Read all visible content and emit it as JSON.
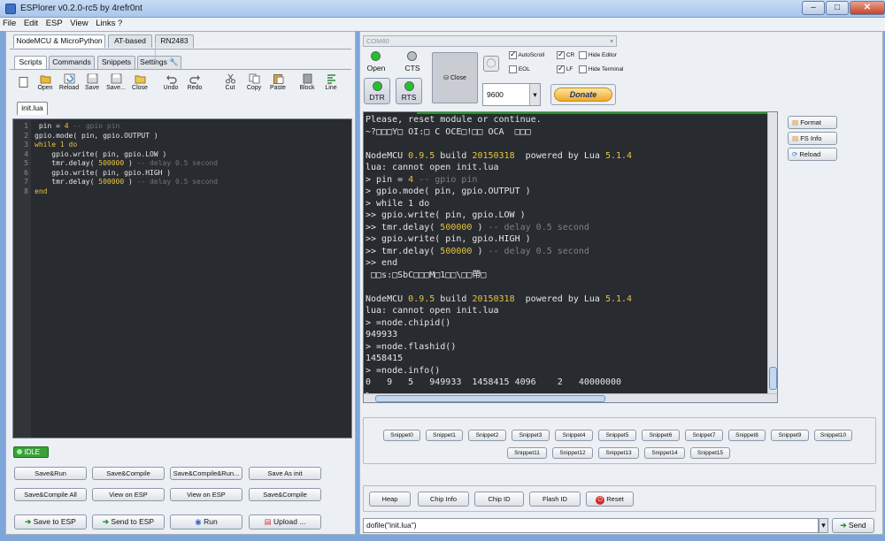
{
  "window": {
    "title": "ESPlorer v0.2.0-rc5 by 4refr0nt",
    "min": "–",
    "max": "□",
    "close": "✕"
  },
  "menu": [
    "File",
    "Edit",
    "ESP",
    "View",
    "Links ?"
  ],
  "left": {
    "device_tabs": [
      "NodeMCU & MicroPython",
      "AT-based",
      "RN2483"
    ],
    "sub_tabs": [
      "Scripts",
      "Commands",
      "Snippets",
      "Settings"
    ],
    "toolbar": [
      "Open",
      "Reload",
      "Save",
      "Save...",
      "Close",
      "Undo",
      "Redo",
      "Cut",
      "Copy",
      "Paste",
      "Block",
      "Line"
    ],
    "file_tab": "init.lua",
    "code_lines": [
      "1",
      "2",
      "3",
      "4",
      "5",
      "6",
      "7",
      "8"
    ],
    "code": {
      "l1a": " pin = ",
      "l1b": "4",
      "l1c": " -- gpio pin",
      "l2": "gpio.mode( pin, gpio.OUTPUT )",
      "l3a": "while 1 do",
      "l4": "    gpio.write( pin, gpio.LOW )",
      "l5a": "    tmr.delay( ",
      "l5b": "500000",
      "l5c": " )",
      "l5d": " -- delay 0.5 second",
      "l6": "    gpio.write( pin, gpio.HIGH )",
      "l7a": "    tmr.delay( ",
      "l7b": "500000",
      "l7c": " )",
      "l7d": " -- delay 0.5 second",
      "l8": "end"
    },
    "status": "IDLE",
    "buttons_row1": [
      "Save&Run",
      "Save&Compile",
      "Save&Compile&Run...",
      "Save As init"
    ],
    "buttons_row2": [
      "Save&Compile All",
      "View on ESP",
      "View on ESP",
      "Save&Compile"
    ],
    "buttons_row3": [
      "Save to ESP",
      "Send to ESP",
      "Run",
      "Upload ..."
    ]
  },
  "right": {
    "port": "COM80",
    "open_label": "Open",
    "cts_label": "CTS",
    "close_label": "Close",
    "dtr_label": "DTR",
    "rts_label": "RTS",
    "autoscroll": "AutoScroll",
    "eol": "EOL",
    "cr": "CR",
    "lf": "LF",
    "hide_editor": "Hide Editor",
    "hide_terminal": "Hide Terminal",
    "baud": "9600",
    "donate": "Donate",
    "side_buttons": [
      "Format",
      "FS Info",
      "Reload"
    ],
    "terminal": {
      "t1": "Please, reset module or continue.",
      "t2": "~?□□□Y□ OI:□ C OCE□!□□ OCA  □□□",
      "t3": "",
      "t4a": "NodeMCU ",
      "t4b": "0.9.5",
      "t4c": " build ",
      "t4d": "20150318",
      "t4e": "  powered by Lua ",
      "t4f": "5.1.4",
      "t5": "lua: cannot open init.lua",
      "t6a": "> pin = ",
      "t6b": "4",
      "t6c": " -- gpio pin",
      "t7": "> gpio.mode( pin, gpio.OUTPUT )",
      "t8": "> while 1 do",
      "t9": ">> gpio.write( pin, gpio.LOW )",
      "t10a": ">> tmr.delay( ",
      "t10b": "500000",
      "t10c": " )",
      "t10d": " -- delay 0.5 second",
      "t11": ">> gpio.write( pin, gpio.HIGH )",
      "t12a": ">> tmr.delay( ",
      "t12b": "500000",
      "t12c": " )",
      "t12d": " -- delay 0.5 second",
      "t13": ">> end",
      "t14": " □□s:□SbC□□□M□1□□\\□□帶□",
      "t15": "",
      "t16a": "NodeMCU ",
      "t16b": "0.9.5",
      "t16c": " build ",
      "t16d": "20150318",
      "t16e": "  powered by Lua ",
      "t16f": "5.1.4",
      "t17": "lua: cannot open init.lua",
      "t18": "> =node.chipid()",
      "t19": "949933",
      "t20": "> =node.flashid()",
      "t21": "1458415",
      "t22": "> =node.info()",
      "t23": "0   9   5   949933  1458415 4096    2   40000000",
      "t24": ">"
    },
    "snippets_row1": [
      "Snippet0",
      "Snippet1",
      "Snippet2",
      "Snippet3",
      "Snippet4",
      "Snippet5",
      "Snippet6",
      "Snippet7",
      "Snippet8",
      "Snippet9",
      "Snippet10"
    ],
    "snippets_row2": [
      "Snippet11",
      "Snippet12",
      "Snippet13",
      "Snippet14",
      "Snippet15"
    ],
    "bottom_buttons": [
      "Heap",
      "Chip Info",
      "Chip ID",
      "Flash ID",
      "Reset"
    ],
    "command_value": "dofile(\"init.lua\")",
    "send": "Send"
  },
  "colors": {
    "terminal_bg": "#282b2f",
    "keyword": "#e8c342",
    "comment": "#7b8088",
    "led_green": "#22c422"
  }
}
